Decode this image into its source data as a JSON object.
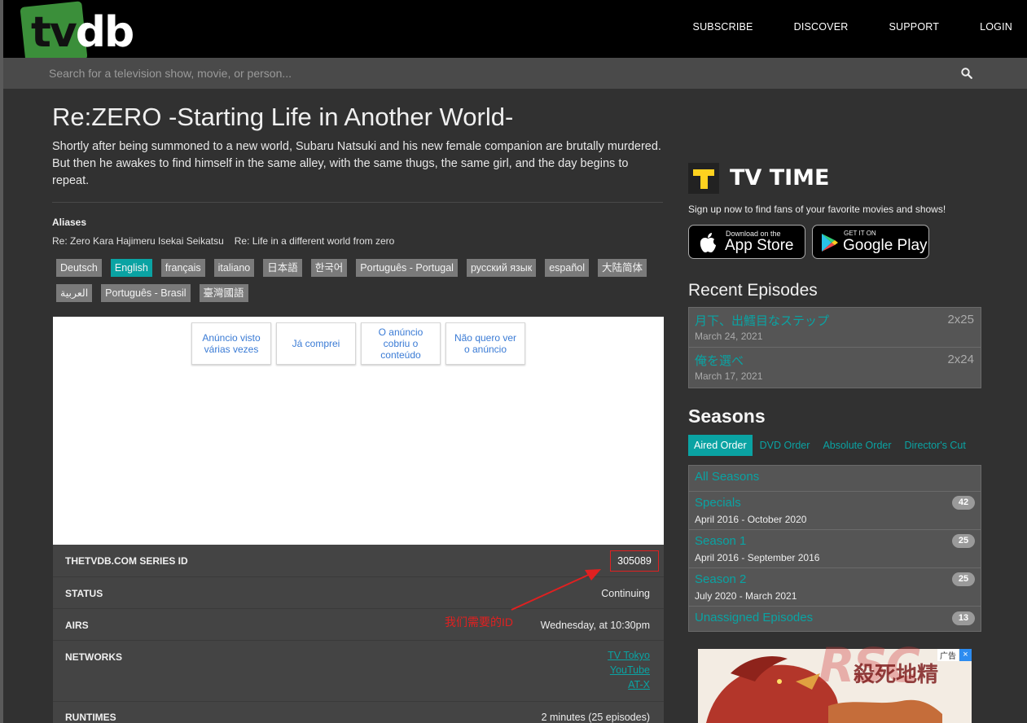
{
  "header": {
    "logo_text": "tvdb",
    "nav": [
      "SUBSCRIBE",
      "DISCOVER",
      "SUPPORT",
      "LOGIN"
    ],
    "search_placeholder": "Search for a television show, movie, or person..."
  },
  "series": {
    "title": "Re:ZERO -Starting Life in Another World-",
    "overview": "Shortly after being summoned to a new world, Subaru Natsuki and his new female companion are brutally murdered. But then he awakes to find himself in the same alley, with the same thugs, the same girl, and the day begins to repeat.",
    "aliases_label": "Aliases",
    "aliases": [
      "Re: Zero Kara Hajimeru Isekai Seikatsu",
      "Re: Life in a different world from zero"
    ],
    "languages": [
      "Deutsch",
      "English",
      "français",
      "italiano",
      "日本語",
      "한국어",
      "Português - Portugal",
      "русский язык",
      "español",
      "大陆简体",
      "العربية",
      "Português - Brasil",
      "臺灣國語"
    ],
    "active_language": "English"
  },
  "ad_feedback": {
    "buttons": [
      "Anúncio visto várias vezes",
      "Já comprei",
      "O anúncio cobriu o conteúdo",
      "Não quero ver o anúncio"
    ]
  },
  "info": {
    "series_id_label": "THETVDB.COM SERIES ID",
    "series_id": "305089",
    "status_label": "STATUS",
    "status": "Continuing",
    "airs_label": "AIRS",
    "airs": "Wednesday, at 10:30pm",
    "networks_label": "NETWORKS",
    "networks": [
      "TV Tokyo",
      "YouTube",
      "AT-X"
    ],
    "runtimes_label": "RUNTIMES",
    "runtimes": "2 minutes (25 episodes)"
  },
  "annotation": {
    "text": "我们需要的ID",
    "color": "#e02020"
  },
  "tvtime": {
    "logo_letter": "T",
    "name": "TV TIME",
    "text": "Sign up now to find fans of your favorite movies and shows!",
    "app_store_small": "Download on the",
    "app_store_big": "App Store",
    "google_small": "GET IT ON",
    "google_big": "Google Play"
  },
  "recent": {
    "title": "Recent Episodes",
    "episodes": [
      {
        "title": "月下、出鱈目なステップ",
        "number": "2x25",
        "date": "March 24, 2021"
      },
      {
        "title": "俺を選べ",
        "number": "2x24",
        "date": "March 17, 2021"
      }
    ]
  },
  "seasons": {
    "title": "Seasons",
    "tabs": [
      "Aired Order",
      "DVD Order",
      "Absolute Order",
      "Director's Cut"
    ],
    "active_tab": "Aired Order",
    "all_label": "All Seasons",
    "rows": [
      {
        "name": "Specials",
        "range": "April 2016 - October 2020",
        "count": "42"
      },
      {
        "name": "Season 1",
        "range": "April 2016 - September 2016",
        "count": "25"
      },
      {
        "name": "Season 2",
        "range": "July 2020 - March 2021",
        "count": "25"
      },
      {
        "name": "Unassigned Episodes",
        "range": "",
        "count": "13"
      }
    ]
  },
  "ad2": {
    "tag": "广告",
    "close": "×"
  },
  "watermark": {
    "latin": "RSC",
    "chinese": "殺死地精"
  },
  "colors": {
    "accent": "#0aa3a3",
    "background": "#313131",
    "topbar": "#000000",
    "annotation": "#e02020"
  }
}
